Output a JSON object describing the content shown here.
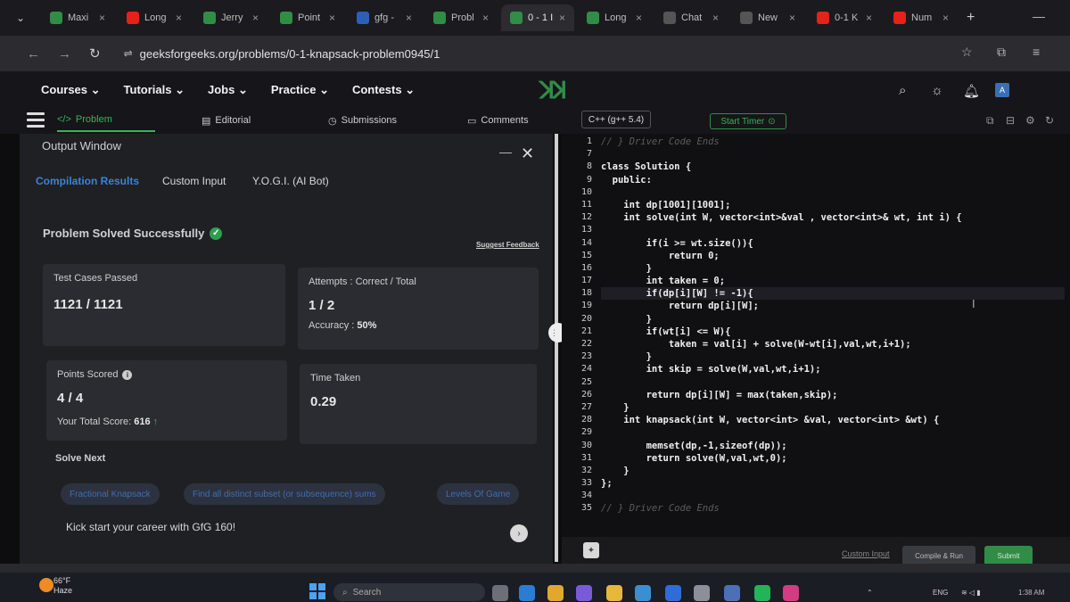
{
  "browser": {
    "tabs": [
      {
        "label": "Maxi",
        "icon": "gfg-icon",
        "color": "#2f8d46"
      },
      {
        "label": "Long",
        "icon": "youtube-icon",
        "color": "#e62117"
      },
      {
        "label": "Jerry",
        "icon": "gfg-icon",
        "color": "#2f8d46"
      },
      {
        "label": "Point",
        "icon": "gfg-icon",
        "color": "#2f8d46"
      },
      {
        "label": "gfg -",
        "icon": "word-icon",
        "color": "#2b5fb8"
      },
      {
        "label": "Probl",
        "icon": "gfg-icon",
        "color": "#2f8d46"
      },
      {
        "label": "0 - 1 I",
        "icon": "gfg-icon",
        "color": "#2f8d46"
      },
      {
        "label": "Long",
        "icon": "gfg-icon",
        "color": "#2f8d46"
      },
      {
        "label": "Chat",
        "icon": "chatgpt-icon",
        "color": "#555555"
      },
      {
        "label": "New",
        "icon": "globe-icon",
        "color": "#555555"
      },
      {
        "label": "0-1 K",
        "icon": "youtube-icon",
        "color": "#e62117"
      },
      {
        "label": "Num",
        "icon": "youtube-icon",
        "color": "#e62117"
      }
    ],
    "url": "geeksforgeeks.org/problems/0-1-knapsack-problem0945/1"
  },
  "site_nav": [
    "Courses",
    "Tutorials",
    "Jobs",
    "Practice",
    "Contests"
  ],
  "problem_tabs": {
    "problem": "Problem",
    "editorial": "Editorial",
    "submissions": "Submissions",
    "comments": "Comments",
    "language": "C++ (g++ 5.4)",
    "timer": "Start Timer"
  },
  "output": {
    "title": "Output Window",
    "tabs": [
      "Compilation Results",
      "Custom Input",
      "Y.O.G.I. (AI Bot)"
    ],
    "status": "Problem Solved Successfully",
    "feedback": "Suggest Feedback",
    "test_cases_label": "Test Cases Passed",
    "test_cases_value": "1121 / 1121",
    "attempts_label": "Attempts : Correct / Total",
    "attempts_value": "1 / 2",
    "accuracy_label": "Accuracy :",
    "accuracy_value": "50%",
    "points_label": "Points Scored",
    "points_value": "4 / 4",
    "total_score_label": "Your Total Score:",
    "total_score_value": "616",
    "time_label": "Time Taken",
    "time_value": "0.29",
    "solve_next": "Solve Next",
    "suggestions": [
      "Fractional Knapsack",
      "Find all distinct subset (or subsequence) sums",
      "Levels Of Game"
    ],
    "kickstart": "Kick start your career with GfG 160!"
  },
  "editor": {
    "line_numbers": [
      "1",
      "7",
      "8",
      "9",
      "10",
      "11",
      "12",
      "13",
      "14",
      "15",
      "16",
      "17",
      "18",
      "19",
      "20",
      "21",
      "22",
      "23",
      "24",
      "25",
      "26",
      "27",
      "28",
      "29",
      "30",
      "31",
      "32",
      "33",
      "34",
      "35"
    ],
    "lines": [
      "// } Driver Code Ends",
      "",
      "class Solution {",
      "  public:",
      "",
      "    int dp[1001][1001];",
      "    int solve(int W, vector<int>&val , vector<int>& wt, int i) {",
      "",
      "        if(i >= wt.size()){",
      "            return 0;",
      "        }",
      "        int taken = 0;",
      "        if(dp[i][W] != -1){",
      "            return dp[i][W];",
      "        }",
      "        if(wt[i] <= W){",
      "            taken = val[i] + solve(W-wt[i],val,wt,i+1);",
      "        }",
      "        int skip = solve(W,val,wt,i+1);",
      "",
      "        return dp[i][W] = max(taken,skip);",
      "    }",
      "    int knapsack(int W, vector<int> &val, vector<int> &wt) {",
      "",
      "        memset(dp,-1,sizeof(dp));",
      "        return solve(W,val,wt,0);",
      "    }",
      "};",
      "",
      "// } Driver Code Ends"
    ],
    "custom_input": "Custom Input",
    "compile_run": "Compile & Run",
    "submit": "Submit"
  },
  "taskbar": {
    "temp": "66°F",
    "weather": "Haze",
    "search": "Search",
    "lang": "ENG",
    "time": "1:38 AM"
  }
}
